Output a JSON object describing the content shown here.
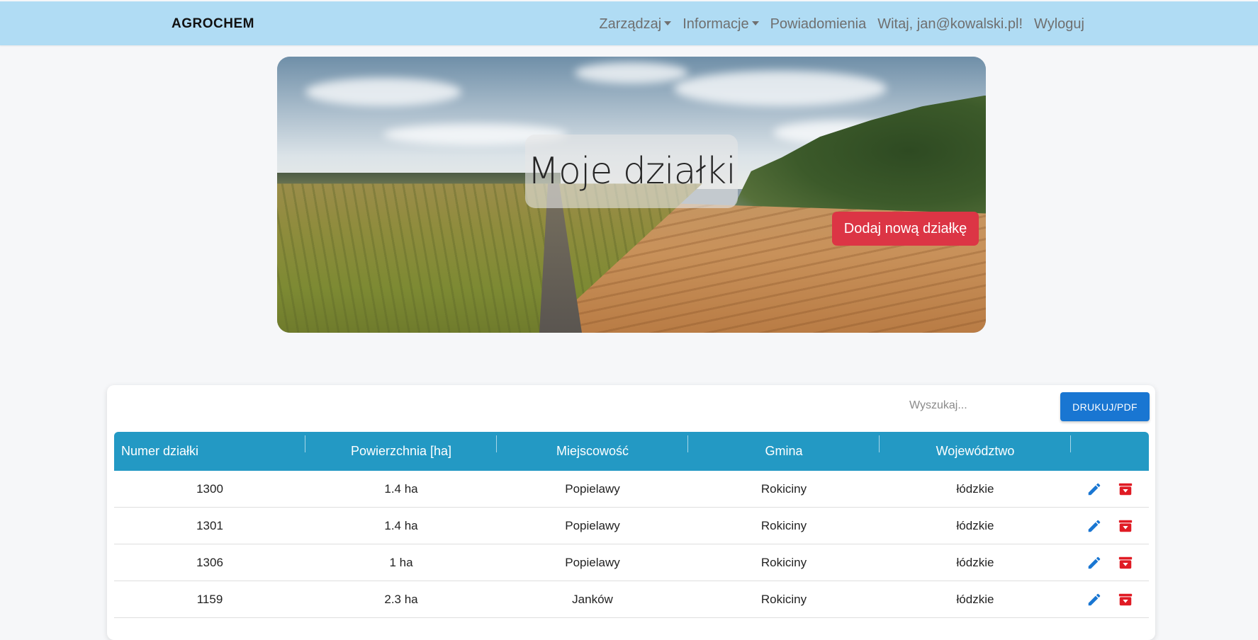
{
  "navbar": {
    "brand": "AGROCHEM",
    "items": [
      {
        "label": "Zarządzaj",
        "dropdown": true
      },
      {
        "label": "Informacje",
        "dropdown": true
      },
      {
        "label": "Powiadomienia",
        "dropdown": false
      },
      {
        "label": "Witaj, jan@kowalski.pl!",
        "dropdown": false
      },
      {
        "label": "Wyloguj",
        "dropdown": false
      }
    ]
  },
  "hero": {
    "title": "Moje działki",
    "add_button": "Dodaj nową działkę"
  },
  "toolbar": {
    "search_placeholder": "Wyszukaj...",
    "print_button": "DRUKUJ/PDF"
  },
  "table": {
    "headers": [
      "Numer działki",
      "Powierzchnia [ha]",
      "Miejscowość",
      "Gmina",
      "Województwo"
    ],
    "rows": [
      [
        "1300",
        "1.4 ha",
        "Popielawy",
        "Rokiciny",
        "łódzkie"
      ],
      [
        "1301",
        "1.4 ha",
        "Popielawy",
        "Rokiciny",
        "łódzkie"
      ],
      [
        "1306",
        "1 ha",
        "Popielawy",
        "Rokiciny",
        "łódzkie"
      ],
      [
        "1159",
        "2.3 ha",
        "Janków",
        "Rokiciny",
        "łódzkie"
      ]
    ],
    "row_actions": [
      "pencil-icon",
      "delete-icon"
    ]
  },
  "colors": {
    "navbar": "#b0dcf4",
    "table_header": "#2399c4",
    "add_button": "#dc3545",
    "print_button": "#1976d2",
    "edit_icon": "#1976d2",
    "delete_icon": "#e01b24"
  }
}
